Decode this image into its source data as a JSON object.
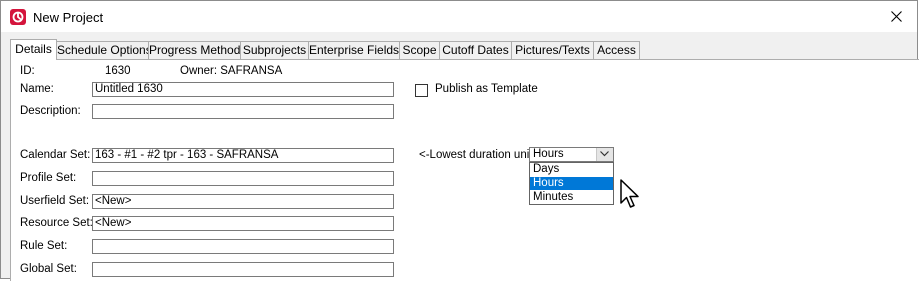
{
  "window": {
    "title": "New Project"
  },
  "tabs": [
    {
      "label": "Details",
      "active": true
    },
    {
      "label": "Schedule Options",
      "active": false
    },
    {
      "label": "Progress Method",
      "active": false
    },
    {
      "label": "Subprojects",
      "active": false
    },
    {
      "label": "Enterprise Fields",
      "active": false
    },
    {
      "label": "Scope",
      "active": false
    },
    {
      "label": "Cutoff Dates",
      "active": false
    },
    {
      "label": "Pictures/Texts",
      "active": false
    },
    {
      "label": "Access",
      "active": false
    }
  ],
  "details": {
    "id_label": "ID:",
    "id_value": "1630",
    "owner_text": "Owner: SAFRANSA",
    "name_label": "Name:",
    "name_value": "Untitled 1630",
    "description_label": "Description:",
    "description_value": "",
    "publish_label": "Publish as Template",
    "publish_checked": false,
    "calendar_label": "Calendar Set:",
    "calendar_value": "163 - #1 - #2 tpr - 163 - SAFRANSA",
    "profile_label": "Profile Set:",
    "profile_value": "",
    "userfield_label": "Userfield Set:",
    "userfield_value": "<New>",
    "resource_label": "Resource Set:",
    "resource_value": "<New>",
    "rule_label": "Rule Set:",
    "rule_value": "",
    "global_label": "Global Set:",
    "global_value": "",
    "duration_label": "<-Lowest duration units",
    "duration_value": "Hours",
    "duration_options": [
      "Days",
      "Hours",
      "Minutes"
    ]
  },
  "colors": {
    "accent": "#0078d7",
    "app_icon": "#d4143c"
  }
}
